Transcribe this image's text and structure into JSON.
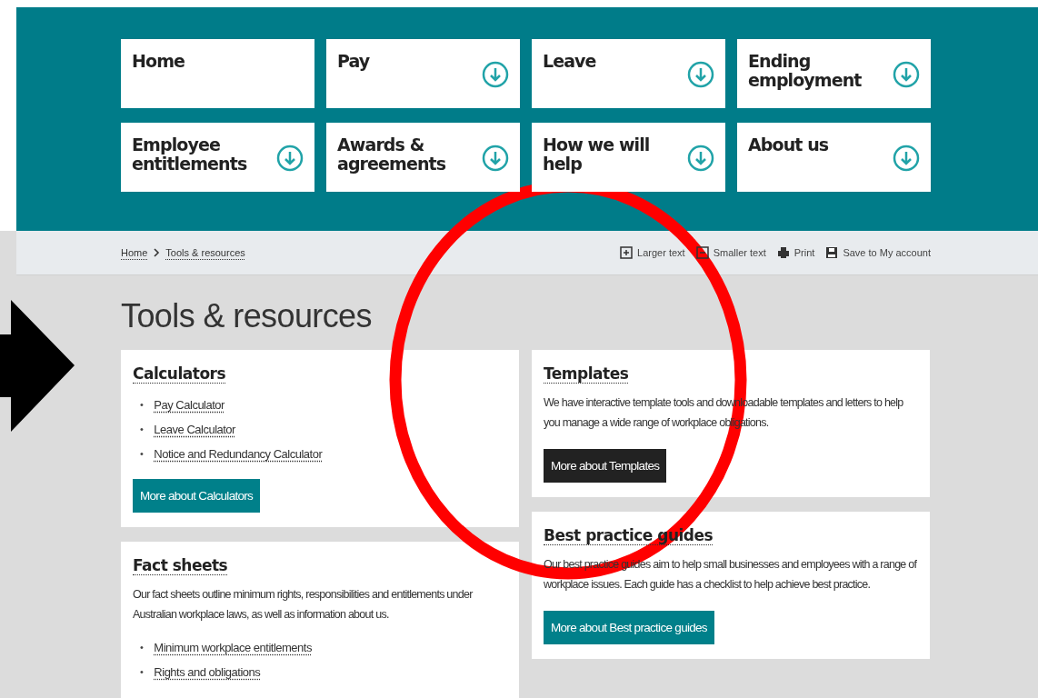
{
  "nav": [
    {
      "label": "Home",
      "dropdown": false
    },
    {
      "label": "Pay",
      "dropdown": true
    },
    {
      "label": "Leave",
      "dropdown": true
    },
    {
      "label": "Ending employment",
      "dropdown": true
    },
    {
      "label": "Employee entitlements",
      "dropdown": true
    },
    {
      "label": "Awards & agreements",
      "dropdown": true
    },
    {
      "label": "How we will help",
      "dropdown": true
    },
    {
      "label": "About us",
      "dropdown": true
    }
  ],
  "breadcrumb": [
    "Home",
    "Tools & resources"
  ],
  "page_tools": [
    {
      "label": "Larger text",
      "kind": "plus"
    },
    {
      "label": "Smaller text",
      "kind": "minus"
    },
    {
      "label": "Print",
      "kind": "print"
    },
    {
      "label": "Save to My account",
      "kind": "save"
    }
  ],
  "title": "Tools & resources",
  "columns": [
    [
      {
        "heading": "Calculators",
        "links": [
          {
            "bullet": "•",
            "label": "Pay Calculator"
          },
          {
            "bullet": "•",
            "label": "Leave Calculator"
          },
          {
            "bullet": "•",
            "label": "Notice and Redundancy Calculator"
          }
        ],
        "button": {
          "label": "More about Calculators",
          "hovered": false
        }
      },
      {
        "heading": "Fact sheets",
        "description": "Our fact sheets outline minimum rights, responsibilities and entitlements under Australian workplace laws, as well as information about us.",
        "links": [
          {
            "bullet": "•",
            "label": "Minimum workplace entitlements"
          },
          {
            "bullet": "•",
            "label": "Rights and obligations"
          }
        ]
      }
    ],
    [
      {
        "heading": "Templates",
        "description": "We have interactive template tools and downloadable templates and letters to help you manage a wide range of workplace obligations.",
        "button": {
          "label": "More about Templates",
          "hovered": true
        }
      },
      {
        "heading": "Best practice guides",
        "description": "Our best practice guides aim to help small businesses and employees with a range of workplace issues. Each guide has a checklist to help achieve best practice.",
        "button": {
          "label": "More about Best practice guides",
          "hovered": false
        }
      }
    ]
  ]
}
